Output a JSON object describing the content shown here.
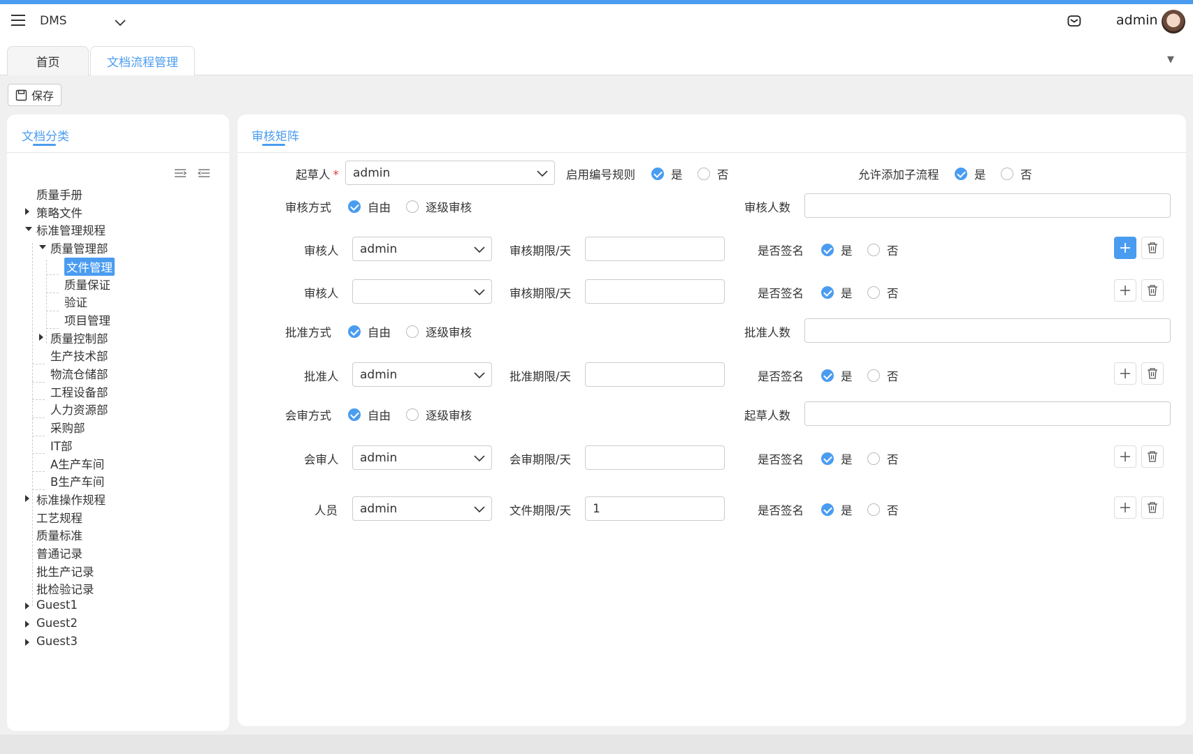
{
  "header": {
    "app_name": "DMS",
    "user_name": "admin"
  },
  "tabs": [
    {
      "label": "首页",
      "active": false
    },
    {
      "label": "文档流程管理",
      "active": true
    }
  ],
  "toolbar": {
    "save_label": "保存"
  },
  "left_panel": {
    "title": "文档分类",
    "tree": [
      {
        "label": "质量手册",
        "level": 0,
        "caret": "none"
      },
      {
        "label": "策略文件",
        "level": 0,
        "caret": "right"
      },
      {
        "label": "标准管理规程",
        "level": 0,
        "caret": "down"
      },
      {
        "label": "质量管理部",
        "level": 1,
        "caret": "down"
      },
      {
        "label": "文件管理",
        "level": 2,
        "caret": "none",
        "selected": true
      },
      {
        "label": "质量保证",
        "level": 2,
        "caret": "none"
      },
      {
        "label": "验证",
        "level": 2,
        "caret": "none"
      },
      {
        "label": "项目管理",
        "level": 2,
        "caret": "none"
      },
      {
        "label": "质量控制部",
        "level": 1,
        "caret": "right"
      },
      {
        "label": "生产技术部",
        "level": 1,
        "caret": "none"
      },
      {
        "label": "物流仓储部",
        "level": 1,
        "caret": "none"
      },
      {
        "label": "工程设备部",
        "level": 1,
        "caret": "none"
      },
      {
        "label": "人力资源部",
        "level": 1,
        "caret": "none"
      },
      {
        "label": "采购部",
        "level": 1,
        "caret": "none"
      },
      {
        "label": "IT部",
        "level": 1,
        "caret": "none"
      },
      {
        "label": "A生产车间",
        "level": 1,
        "caret": "none"
      },
      {
        "label": "B生产车间",
        "level": 1,
        "caret": "none"
      },
      {
        "label": "标准操作规程",
        "level": 0,
        "caret": "right"
      },
      {
        "label": "工艺规程",
        "level": 0,
        "caret": "none"
      },
      {
        "label": "质量标准",
        "level": 0,
        "caret": "none"
      },
      {
        "label": "普通记录",
        "level": 0,
        "caret": "none"
      },
      {
        "label": "批生产记录",
        "level": 0,
        "caret": "none"
      },
      {
        "label": "批检验记录",
        "level": 0,
        "caret": "none"
      },
      {
        "label": "Guest1",
        "level": 0,
        "caret": "right"
      },
      {
        "label": "Guest2",
        "level": 0,
        "caret": "right"
      },
      {
        "label": "Guest3",
        "level": 0,
        "caret": "right"
      }
    ]
  },
  "right_panel": {
    "title": "审核矩阵",
    "drafter_label": "起草人",
    "drafter_value": "admin",
    "enable_numbering_label": "启用编号规则",
    "allow_subflow_label": "允许添加子流程",
    "yes": "是",
    "no": "否",
    "free": "自由",
    "stepwise": "逐级审核",
    "review_mode_label": "审核方式",
    "reviewer_count_label": "审核人数",
    "approve_mode_label": "批准方式",
    "approver_count_label": "批准人数",
    "countersign_mode_label": "会审方式",
    "drafter_count_label": "起草人数",
    "sign_label": "是否签名",
    "rows": [
      {
        "label": "审核人",
        "select": "admin",
        "term_label": "审核期限/天",
        "term_value": ""
      },
      {
        "label": "审核人",
        "select": "",
        "term_label": "审核期限/天",
        "term_value": ""
      },
      {
        "label": "批准人",
        "select": "admin",
        "term_label": "批准期限/天",
        "term_value": ""
      },
      {
        "label": "会审人",
        "select": "admin",
        "term_label": "会审期限/天",
        "term_value": ""
      },
      {
        "label": "人员",
        "select": "admin",
        "term_label": "文件期限/天",
        "term_value": "1"
      }
    ]
  }
}
